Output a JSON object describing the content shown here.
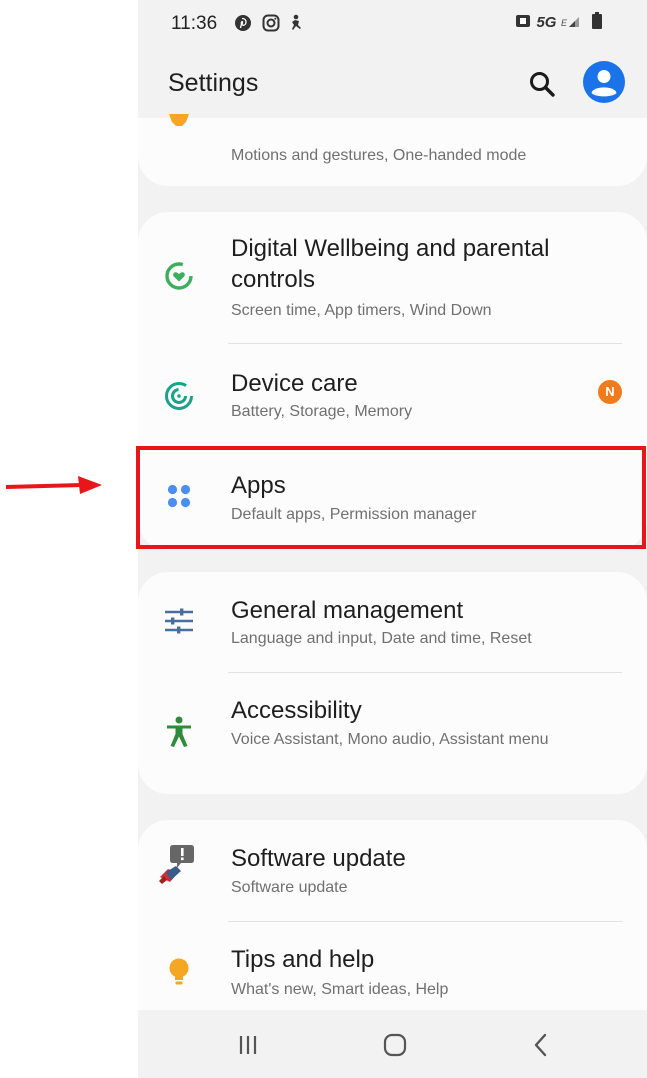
{
  "status_bar": {
    "time": "11:36",
    "network": "5G"
  },
  "header": {
    "title": "Settings"
  },
  "sections": {
    "advanced": {
      "subtitle": "Motions and gestures, One-handed mode"
    },
    "wellbeing": {
      "title": "Digital Wellbeing and parental controls",
      "subtitle": "Screen time, App timers, Wind Down"
    },
    "device_care": {
      "title": "Device care",
      "subtitle": "Battery, Storage, Memory",
      "badge": "N"
    },
    "apps": {
      "title": "Apps",
      "subtitle": "Default apps, Permission manager"
    },
    "general": {
      "title": "General management",
      "subtitle": "Language and input, Date and time, Reset"
    },
    "accessibility": {
      "title": "Accessibility",
      "subtitle": "Voice Assistant, Mono audio, Assistant menu"
    },
    "software_update": {
      "title": "Software update",
      "subtitle": "Software update"
    },
    "tips": {
      "title": "Tips and help",
      "subtitle": "What's new, Smart ideas, Help"
    }
  },
  "icons": {
    "advanced": "gear-partial-icon",
    "wellbeing": "wellbeing-icon",
    "device_care": "device-care-icon",
    "apps": "apps-grid-icon",
    "general": "sliders-icon",
    "accessibility": "accessibility-icon",
    "software_update": "software-update-icon",
    "tips": "lightbulb-icon"
  },
  "colors": {
    "accent_blue": "#1a73e8",
    "wellbeing_green": "#3dae5b",
    "device_care_teal": "#1aa38a",
    "apps_blue": "#4a8ff0",
    "general_blue": "#4a6f9a",
    "accessibility_green": "#2e8b3a",
    "tips_orange": "#f5a623",
    "badge_orange": "#f07b1c",
    "highlight_red": "#e8151b"
  }
}
